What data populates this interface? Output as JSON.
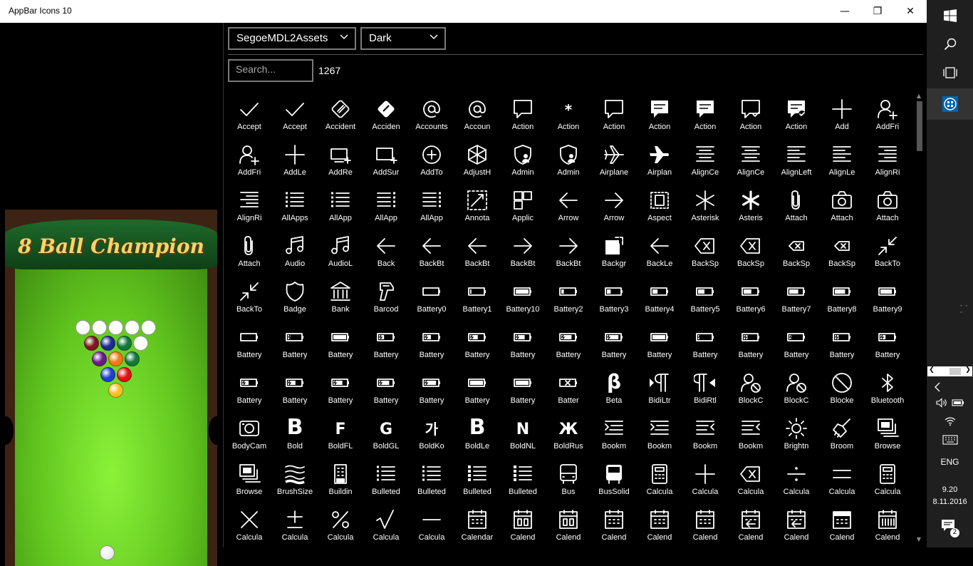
{
  "window": {
    "title": "AppBar Icons 10",
    "minimize_glyph": "—",
    "maximize_glyph": "❐",
    "close_glyph": "✕"
  },
  "ad": {
    "title": "8 Ball Champion"
  },
  "toolbar": {
    "font_select": "SegoeMDL2Assets",
    "theme_select": "Dark",
    "search_placeholder": "Search...",
    "result_count": "1267"
  },
  "icons": [
    {
      "label": "Accept",
      "icon": "check"
    },
    {
      "label": "Accept",
      "icon": "check"
    },
    {
      "label": "Accident",
      "icon": "accident"
    },
    {
      "label": "Acciden",
      "icon": "accident-solid"
    },
    {
      "label": "Accounts",
      "icon": "at"
    },
    {
      "label": "Accoun",
      "icon": "at"
    },
    {
      "label": "Action",
      "icon": "speech"
    },
    {
      "label": "Action",
      "icon": "asterisk-small"
    },
    {
      "label": "Action",
      "icon": "speech"
    },
    {
      "label": "Action",
      "icon": "speech-solid"
    },
    {
      "label": "Action",
      "icon": "speech-solid"
    },
    {
      "label": "Action",
      "icon": "speech-check"
    },
    {
      "label": "Action",
      "icon": "speech-solid-check"
    },
    {
      "label": "Add",
      "icon": "plus"
    },
    {
      "label": "AddFri",
      "icon": "add-friend"
    },
    {
      "label": "AddFri",
      "icon": "add-friend"
    },
    {
      "label": "AddLe",
      "icon": "plus"
    },
    {
      "label": "AddRe",
      "icon": "add-remote"
    },
    {
      "label": "AddSur",
      "icon": "add-surface"
    },
    {
      "label": "AddTo",
      "icon": "circle-plus"
    },
    {
      "label": "AdjustH",
      "icon": "cube"
    },
    {
      "label": "Admin",
      "icon": "shield-person"
    },
    {
      "label": "Admin",
      "icon": "shield-person"
    },
    {
      "label": "Airplane",
      "icon": "airplane"
    },
    {
      "label": "Airplan",
      "icon": "airplane-solid"
    },
    {
      "label": "AlignCe",
      "icon": "align-center"
    },
    {
      "label": "AlignCe",
      "icon": "align-center"
    },
    {
      "label": "AlignLeft",
      "icon": "align-left"
    },
    {
      "label": "AlignLe",
      "icon": "align-left"
    },
    {
      "label": "AlignRi",
      "icon": "align-right"
    },
    {
      "label": "AlignRi",
      "icon": "align-right"
    },
    {
      "label": "AllApps",
      "icon": "list-bullets"
    },
    {
      "label": "AllApp",
      "icon": "list-bullets"
    },
    {
      "label": "AllApp",
      "icon": "list-bullets-right"
    },
    {
      "label": "AllApp",
      "icon": "list-bullets-right"
    },
    {
      "label": "Annota",
      "icon": "annotation"
    },
    {
      "label": "Applic",
      "icon": "app-blocks"
    },
    {
      "label": "Arrow",
      "icon": "arrow-left"
    },
    {
      "label": "Arrow",
      "icon": "arrow-right"
    },
    {
      "label": "Aspect",
      "icon": "aspect"
    },
    {
      "label": "Asterisk",
      "icon": "asterisk"
    },
    {
      "label": "Asteris",
      "icon": "asterisk-bold"
    },
    {
      "label": "Attach",
      "icon": "paperclip"
    },
    {
      "label": "Attach",
      "icon": "camera"
    },
    {
      "label": "Attach",
      "icon": "camera"
    },
    {
      "label": "Attach",
      "icon": "paperclip"
    },
    {
      "label": "Audio",
      "icon": "music"
    },
    {
      "label": "AudioL",
      "icon": "music"
    },
    {
      "label": "Back",
      "icon": "arrow-left"
    },
    {
      "label": "BackBt",
      "icon": "arrow-left"
    },
    {
      "label": "BackBt",
      "icon": "arrow-left"
    },
    {
      "label": "BackBt",
      "icon": "arrow-right"
    },
    {
      "label": "BackBt",
      "icon": "arrow-right"
    },
    {
      "label": "Backgr",
      "icon": "background"
    },
    {
      "label": "BackLe",
      "icon": "arrow-left"
    },
    {
      "label": "BackSp",
      "icon": "backspace"
    },
    {
      "label": "BackSp",
      "icon": "backspace"
    },
    {
      "label": "BackSp",
      "icon": "backspace-small"
    },
    {
      "label": "BackSp",
      "icon": "backspace-small"
    },
    {
      "label": "BackTo",
      "icon": "shrink"
    },
    {
      "label": "BackTo",
      "icon": "shrink"
    },
    {
      "label": "Badge",
      "icon": "badge"
    },
    {
      "label": "Bank",
      "icon": "bank"
    },
    {
      "label": "Barcod",
      "icon": "barcode-gun"
    },
    {
      "label": "Battery0",
      "icon": "battery-0"
    },
    {
      "label": "Battery1",
      "icon": "battery-1"
    },
    {
      "label": "Battery10",
      "icon": "battery-full"
    },
    {
      "label": "Battery2",
      "icon": "battery-2"
    },
    {
      "label": "Battery3",
      "icon": "battery-3"
    },
    {
      "label": "Battery4",
      "icon": "battery-4"
    },
    {
      "label": "Battery5",
      "icon": "battery-5"
    },
    {
      "label": "Battery6",
      "icon": "battery-6"
    },
    {
      "label": "Battery7",
      "icon": "battery-7"
    },
    {
      "label": "Battery8",
      "icon": "battery-8"
    },
    {
      "label": "Battery9",
      "icon": "battery-9"
    },
    {
      "label": "Battery",
      "icon": "battery-charge-0"
    },
    {
      "label": "Battery",
      "icon": "battery-charge-2"
    },
    {
      "label": "Battery",
      "icon": "battery-full"
    },
    {
      "label": "Battery",
      "icon": "battery-charge-4"
    },
    {
      "label": "Battery",
      "icon": "battery-charge-5"
    },
    {
      "label": "Battery",
      "icon": "battery-charge-6"
    },
    {
      "label": "Battery",
      "icon": "battery-charge-7"
    },
    {
      "label": "Battery",
      "icon": "battery-charge-8"
    },
    {
      "label": "Battery",
      "icon": "battery-charge-9"
    },
    {
      "label": "Battery",
      "icon": "battery-full"
    },
    {
      "label": "Battery",
      "icon": "battery-charge-1"
    },
    {
      "label": "Battery",
      "icon": "battery-charge-3"
    },
    {
      "label": "Battery",
      "icon": "battery-charge-2"
    },
    {
      "label": "Battery",
      "icon": "battery-charge-3"
    },
    {
      "label": "Battery",
      "icon": "battery-charge-4"
    },
    {
      "label": "Battery",
      "icon": "battery-charge-5"
    },
    {
      "label": "Battery",
      "icon": "battery-charge-6"
    },
    {
      "label": "Battery",
      "icon": "battery-charge-7"
    },
    {
      "label": "Battery",
      "icon": "battery-charge-8"
    },
    {
      "label": "Battery",
      "icon": "battery-charge-9"
    },
    {
      "label": "Battery",
      "icon": "battery-full"
    },
    {
      "label": "Battery",
      "icon": "battery-full"
    },
    {
      "label": "Batter",
      "icon": "battery-x"
    },
    {
      "label": "Beta",
      "icon": "beta"
    },
    {
      "label": "BidiLtr",
      "icon": "bidi-ltr"
    },
    {
      "label": "BidiRtl",
      "icon": "bidi-rtl"
    },
    {
      "label": "BlockC",
      "icon": "block-contact"
    },
    {
      "label": "BlockC",
      "icon": "block-contact"
    },
    {
      "label": "Blocke",
      "icon": "blocked"
    },
    {
      "label": "Bluetooth",
      "icon": "bluetooth"
    },
    {
      "label": "BodyCam",
      "icon": "body-cam"
    },
    {
      "label": "Bold",
      "icon": "bold-b"
    },
    {
      "label": "BoldFL",
      "icon": "bold-f"
    },
    {
      "label": "BoldGL",
      "icon": "bold-g"
    },
    {
      "label": "BoldKo",
      "icon": "bold-ko"
    },
    {
      "label": "BoldLe",
      "icon": "bold-b"
    },
    {
      "label": "BoldNL",
      "icon": "bold-n"
    },
    {
      "label": "BoldRus",
      "icon": "bold-zh"
    },
    {
      "label": "Bookm",
      "icon": "bookmarks-right"
    },
    {
      "label": "Bookm",
      "icon": "bookmarks-right"
    },
    {
      "label": "Bookm",
      "icon": "bookmarks-left"
    },
    {
      "label": "Bookm",
      "icon": "bookmarks-left"
    },
    {
      "label": "Brightn",
      "icon": "sun"
    },
    {
      "label": "Broom",
      "icon": "broom"
    },
    {
      "label": "Browse",
      "icon": "browse-photos"
    },
    {
      "label": "Browse",
      "icon": "browse-photos"
    },
    {
      "label": "BrushSize",
      "icon": "brush-size"
    },
    {
      "label": "Buildin",
      "icon": "building"
    },
    {
      "label": "Bulleted",
      "icon": "list-bullets"
    },
    {
      "label": "Bulleted",
      "icon": "list-bullets"
    },
    {
      "label": "Bulleted",
      "icon": "list-bullets-bold"
    },
    {
      "label": "Bulleted",
      "icon": "list-bullets-bold"
    },
    {
      "label": "Bus",
      "icon": "bus"
    },
    {
      "label": "BusSolid",
      "icon": "bus-solid"
    },
    {
      "label": "Calcula",
      "icon": "calculator"
    },
    {
      "label": "Calcula",
      "icon": "plus"
    },
    {
      "label": "Calcula",
      "icon": "backspace"
    },
    {
      "label": "Calcula",
      "icon": "divide"
    },
    {
      "label": "Calcula",
      "icon": "equals"
    },
    {
      "label": "Calcula",
      "icon": "calculator"
    },
    {
      "label": "Calcula",
      "icon": "multiply"
    },
    {
      "label": "Calcula",
      "icon": "plus-minus"
    },
    {
      "label": "Calcula",
      "icon": "percent"
    },
    {
      "label": "Calcula",
      "icon": "sqrt"
    },
    {
      "label": "Calcula",
      "icon": "minus"
    },
    {
      "label": "Calendar",
      "icon": "calendar"
    },
    {
      "label": "Calend",
      "icon": "calendar-day"
    },
    {
      "label": "Calend",
      "icon": "calendar-day"
    },
    {
      "label": "Calend",
      "icon": "calendar"
    },
    {
      "label": "Calend",
      "icon": "calendar"
    },
    {
      "label": "Calend",
      "icon": "calendar"
    },
    {
      "label": "Calend",
      "icon": "calendar-reply"
    },
    {
      "label": "Calend",
      "icon": "calendar-reply"
    },
    {
      "label": "Calend",
      "icon": "calendar-solid"
    },
    {
      "label": "Calend",
      "icon": "calendar-week"
    }
  ],
  "taskbar": {
    "language": "ENG",
    "time": "9.20",
    "date": "8.11.2016",
    "notification_count": "2"
  }
}
